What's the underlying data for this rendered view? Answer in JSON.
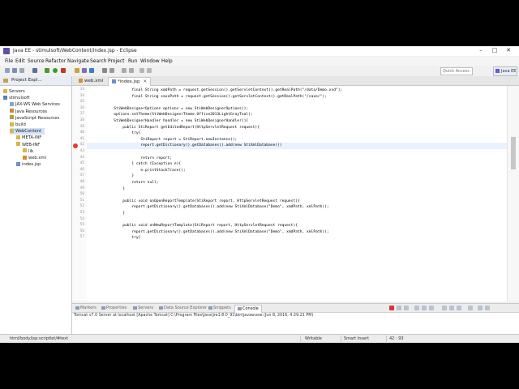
{
  "window": {
    "title": "Java EE - stimulsoft/WebContent/index.jsp - Eclipse"
  },
  "menu": [
    "File",
    "Edit",
    "Source",
    "Refactor",
    "Navigate",
    "Search",
    "Project",
    "Run",
    "Window",
    "Help"
  ],
  "toolbar": {
    "quick_access_placeholder": "Quick Access",
    "perspective_label": "Java EE"
  },
  "project_explorer": {
    "title": "Project Expl...",
    "items": [
      {
        "label": "Servers",
        "depth": 0,
        "icon": "folder-icon"
      },
      {
        "label": "stimulsoft",
        "depth": 0,
        "icon": "project-icon"
      },
      {
        "label": "JAX-WS Web Services",
        "depth": 1,
        "icon": "service-icon"
      },
      {
        "label": "Java Resources",
        "depth": 1,
        "icon": "java-resources-icon"
      },
      {
        "label": "JavaScript Resources",
        "depth": 1,
        "icon": "js-resources-icon"
      },
      {
        "label": "build",
        "depth": 1,
        "icon": "folder-icon"
      },
      {
        "label": "WebContent",
        "depth": 1,
        "icon": "folder-icon",
        "selected": true
      },
      {
        "label": "META-INF",
        "depth": 2,
        "icon": "folder-icon"
      },
      {
        "label": "WEB-INF",
        "depth": 2,
        "icon": "folder-icon"
      },
      {
        "label": "lib",
        "depth": 3,
        "icon": "folder-icon"
      },
      {
        "label": "web.xml",
        "depth": 3,
        "icon": "xml-file-icon"
      },
      {
        "label": "index.jsp",
        "depth": 2,
        "icon": "jsp-file-icon"
      }
    ]
  },
  "editor": {
    "tabs": [
      {
        "label": "web.xml",
        "active": false
      },
      {
        "label": "*index.jsp",
        "active": true
      }
    ],
    "lines": [
      {
        "no": "33",
        "text": "                    final String xmdPath = request.getSession().getServletContext().getRealPath(\"/data/Demo.xsd\");"
      },
      {
        "no": "34",
        "text": "                    final String savePath = request.getSession().getServletContext().getRealPath(\"/save/\");"
      },
      {
        "no": "35",
        "text": ""
      },
      {
        "no": "36",
        "text": "            StiWebDesignerOptions options = new StiWebDesignerOptions();"
      },
      {
        "no": "37",
        "text": "            options.setTheme(StiWebDesignerTheme.Office2013LightGrayTeal);"
      },
      {
        "no": "38",
        "text": "            StiWebDesignerHandler handler = new StiWebDesignerHandler(){"
      },
      {
        "no": "39",
        "text": "                public StiReport getEditedReport(HttpServletRequest request){"
      },
      {
        "no": "40",
        "text": "                    try{"
      },
      {
        "no": "41",
        "text": "                        StiReport report = StiReport.newInstance();"
      },
      {
        "no": "42",
        "text": "                        report.getDictionary().getDatabases().add(new StiXmlDatabase())",
        "error": true,
        "current": true
      },
      {
        "no": "43",
        "text": ""
      },
      {
        "no": "44",
        "text": "                        return report;"
      },
      {
        "no": "45",
        "text": "                    } catch (Exception e){"
      },
      {
        "no": "46",
        "text": "                        e.printStackTrace();"
      },
      {
        "no": "47",
        "text": "                    }"
      },
      {
        "no": "48",
        "text": "                    return null;"
      },
      {
        "no": "49",
        "text": "                }"
      },
      {
        "no": "50",
        "text": ""
      },
      {
        "no": "51",
        "text": "                public void onOpenReportTemplate(StiReport report, HttpServletRequest request){"
      },
      {
        "no": "52",
        "text": "                    report.getDictionary().getDatabases().add(new StiXmlDatabase(\"Demo\", xmdPath, xmlPath));"
      },
      {
        "no": "53",
        "text": "                }"
      },
      {
        "no": "54",
        "text": ""
      },
      {
        "no": "55",
        "text": "                public void onNewReportTemplate(StiReport report, HttpServletRequest request){"
      },
      {
        "no": "56",
        "text": "                    report.getDictionary().getDatabases().add(new StiXmlDatabase(\"Demo\", xmdPath, xmlPath));"
      },
      {
        "no": "57",
        "text": "                    try{"
      }
    ]
  },
  "views": {
    "tabs": [
      {
        "label": "Markers",
        "active": false
      },
      {
        "label": "Properties",
        "active": false
      },
      {
        "label": "Servers",
        "active": false
      },
      {
        "label": "Data Source Explorer",
        "active": false
      },
      {
        "label": "Snippets",
        "active": false
      },
      {
        "label": "Console",
        "active": true
      }
    ],
    "console_line": "Tomcat v7.0 Server at localhost [Apache Tomcat] C:\\Program Files\\Java\\jre1.8.0_91\\bin\\javaw.exe (Jun 8, 2016, 4:29:21 PM)"
  },
  "status": {
    "path": "html/body/jsp:scriptlet/#text",
    "writable": "Writable",
    "insert": "Smart Insert",
    "position": "42 : 93"
  }
}
